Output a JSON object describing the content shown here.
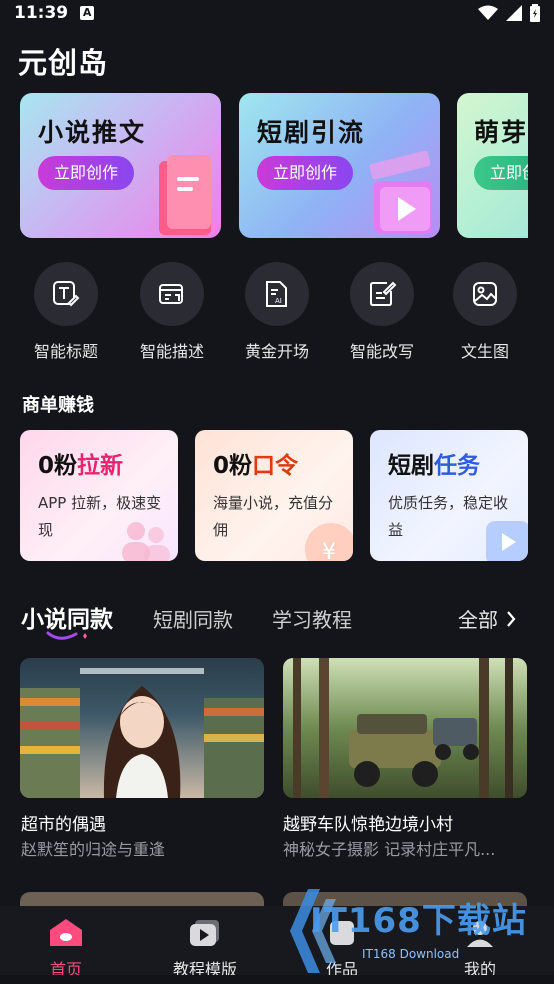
{
  "status": {
    "time": "11:39",
    "badge": "A"
  },
  "app_title": "元创岛",
  "banners": [
    {
      "title": "小说推文",
      "button": "立即创作"
    },
    {
      "title": "短剧引流",
      "button": "立即创作"
    },
    {
      "title": "萌芽",
      "button": "立即创作"
    }
  ],
  "tools": [
    {
      "label": "智能标题",
      "icon": "title-edit-icon"
    },
    {
      "label": "智能描述",
      "icon": "description-icon"
    },
    {
      "label": "黄金开场",
      "icon": "ai-document-icon"
    },
    {
      "label": "智能改写",
      "icon": "rewrite-icon"
    },
    {
      "label": "文生图",
      "icon": "image-gallery-icon"
    }
  ],
  "section_title": "商单赚钱",
  "cards": [
    {
      "title_a": "0粉",
      "title_b": "拉新",
      "desc": "APP 拉新，极速变现",
      "accent": "#e8236f"
    },
    {
      "title_a": "0粉",
      "title_b": "口令",
      "desc": "海量小说，充值分佣",
      "accent": "#e03a10"
    },
    {
      "title_a": "短剧",
      "title_b": "任务",
      "desc": "优质任务，稳定收益",
      "accent": "#2f5de0"
    }
  ],
  "tabs": [
    "小说同款",
    "短剧同款",
    "学习教程"
  ],
  "tabs_all": "全部",
  "videos": [
    {
      "title": "超市的偶遇",
      "subtitle": "赵默笙的归途与重逢"
    },
    {
      "title": "越野车队惊艳边境小村",
      "subtitle": "神秘女子摄影 记录村庄平凡..."
    }
  ],
  "nav": [
    {
      "label": "首页"
    },
    {
      "label": "教程模版"
    },
    {
      "label": "作品"
    },
    {
      "label": "我的"
    }
  ],
  "watermark": {
    "main": "IT168下载站",
    "sub": "IT168 Download"
  }
}
